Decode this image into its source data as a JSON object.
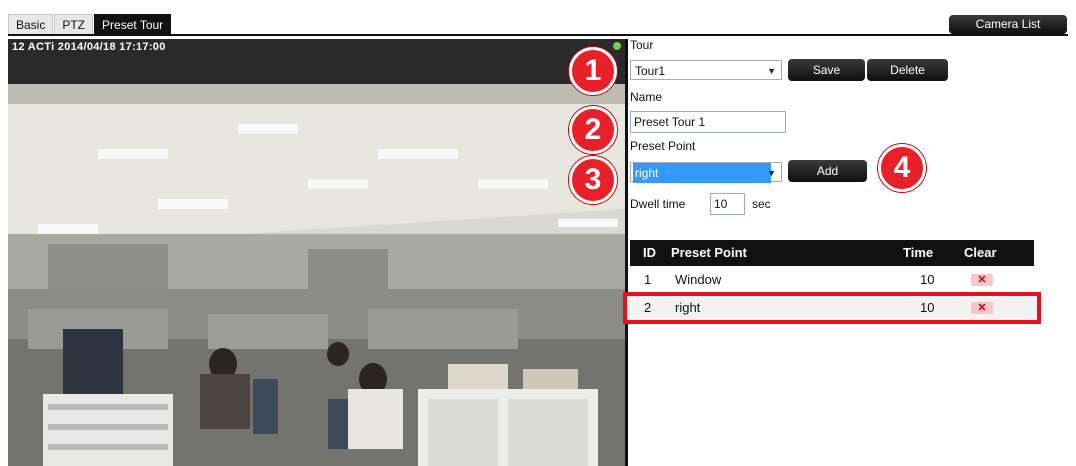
{
  "tabs": [
    {
      "label": "Basic"
    },
    {
      "label": "PTZ"
    },
    {
      "label": "Preset Tour"
    }
  ],
  "header": {
    "camera_list_label": "Camera List"
  },
  "video": {
    "osd_text": "12 ACTi  2014/04/18 17:17:00"
  },
  "tour": {
    "label": "Tour",
    "selected": "Tour1",
    "save_label": "Save",
    "delete_label": "Delete"
  },
  "name": {
    "label": "Name",
    "value": "Preset Tour 1"
  },
  "preset_point": {
    "label": "Preset Point",
    "selected": "right",
    "add_label": "Add"
  },
  "dwell": {
    "label": "Dwell time",
    "value": "10",
    "unit": "sec"
  },
  "table": {
    "headers": {
      "id": "ID",
      "preset_point": "Preset Point",
      "time": "Time",
      "clear": "Clear"
    },
    "rows": [
      {
        "id": "1",
        "preset_point": "Window",
        "time": "10"
      },
      {
        "id": "2",
        "preset_point": "right",
        "time": "10"
      }
    ]
  },
  "callouts": [
    "1",
    "2",
    "3",
    "4"
  ],
  "colors": {
    "accent": "#e8202a",
    "highlight": "#3399ff",
    "active_tab": "#111111"
  }
}
